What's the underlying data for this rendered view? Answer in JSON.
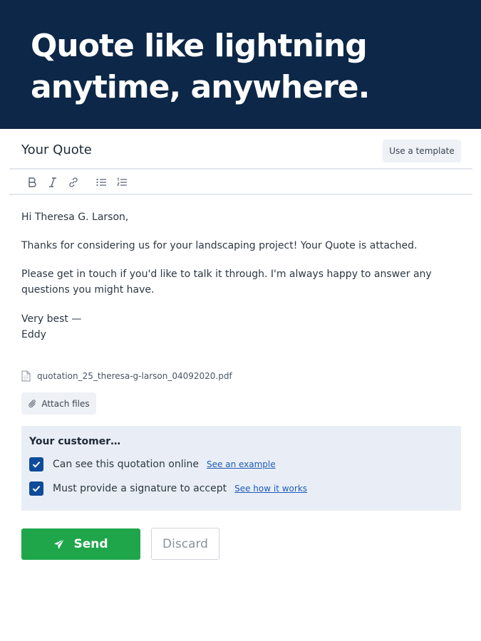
{
  "banner": {
    "headline_line1": "Quote like lightning",
    "headline_line2": "anytime, anywhere.",
    "background_color": "#0c2747"
  },
  "composer": {
    "title": "Your Quote",
    "template_button_label": "Use a template",
    "toolbar": {
      "icons": [
        "bold-icon",
        "italic-icon",
        "link-icon",
        "bulleted-list-icon",
        "numbered-list-icon"
      ]
    },
    "message": {
      "greeting": "Hi Theresa G. Larson,",
      "paragraph1": "Thanks for considering us for your landscaping project! Your Quote is attached.",
      "paragraph2_line1": "Please get in touch if you'd like to talk it through. I'm always happy to answer any",
      "paragraph2_line2": "questions you might have.",
      "signoff": "Very best —",
      "signature": "Eddy"
    },
    "attachment": {
      "filename": "quotation_25_theresa-g-larson_04092020.pdf",
      "icon": "document-icon"
    },
    "attach_button_label": "Attach files"
  },
  "customer": {
    "title": "Your customer…",
    "options": [
      {
        "label": "Can see this quotation online",
        "link": "See an example",
        "checked": true
      },
      {
        "label": "Must provide a signature to accept",
        "link": "See how it works",
        "checked": true
      }
    ],
    "panel_color": "#e9eef6",
    "checkbox_color": "#0f4b9a"
  },
  "actions": {
    "send_label": "Send",
    "discard_label": "Discard",
    "send_color": "#1fa64a"
  }
}
